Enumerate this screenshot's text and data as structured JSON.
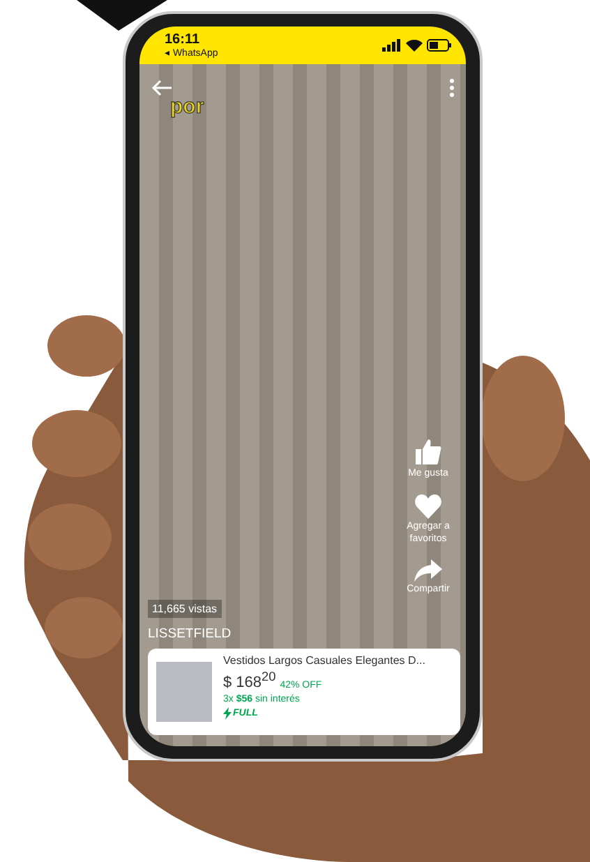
{
  "status_bar": {
    "time": "16:11",
    "back_app": "◂ WhatsApp"
  },
  "video": {
    "caption": "por",
    "views": "11,665 vistas",
    "username": "LISSETFIELD"
  },
  "actions": [
    {
      "kind": "like",
      "label": "Me gusta"
    },
    {
      "kind": "favorite",
      "label": "Agregar a favoritos"
    },
    {
      "kind": "share",
      "label": "Compartir"
    }
  ],
  "product": {
    "title": "Vestidos Largos Casuales Elegantes D...",
    "price": "$ 168$^{20}$",
    "discount": "42% OFF",
    "installments": "3x **$56** sin interés",
    "shipping": "FULL"
  }
}
